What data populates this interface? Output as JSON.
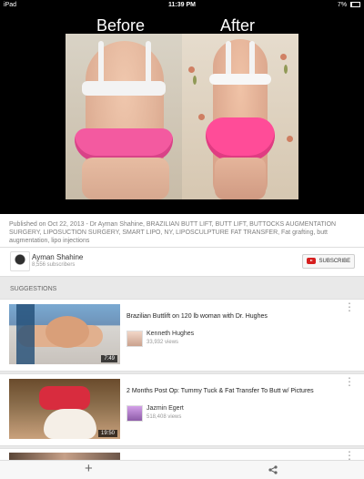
{
  "status_bar": {
    "device": "iPad",
    "time": "11:39 PM",
    "battery": "7%"
  },
  "video": {
    "caption_before": "Before",
    "caption_after": "After"
  },
  "description": {
    "text": "Published on Oct 22, 2013 - Dr Ayman Shahine, BRAZILIAN BUTT LIFT, BUTT LIFT, BUTTOCKS AUGMENTATION SURGERY, LIPOSUCTION SURGERY, SMART LIPO, NY, LIPOSCULPTURE FAT TRANSFER, Fat grafting, butt augmentation, lipo injections"
  },
  "channel": {
    "name": "Ayman Shahine",
    "subscribers": "8,556 subscribers",
    "subscribe_label": "SUBSCRIBE"
  },
  "suggestions": {
    "title": "SUGGESTIONS",
    "items": [
      {
        "title": "Brazilian Buttlift on 120 lb woman with Dr. Hughes",
        "author": "Kenneth Hughes",
        "views": "33,932 views",
        "duration": "7:49"
      },
      {
        "title": "2 Months Post Op: Tummy Tuck & Fat Transfer To Butt w/ Pictures",
        "author": "Jazmin Egert",
        "views": "518,408 views",
        "duration": "19:50"
      }
    ]
  },
  "colors": {
    "accent": "#d61f1f",
    "pink": "#ff4c98"
  },
  "icons": {
    "more": "⋮",
    "add": "+"
  }
}
